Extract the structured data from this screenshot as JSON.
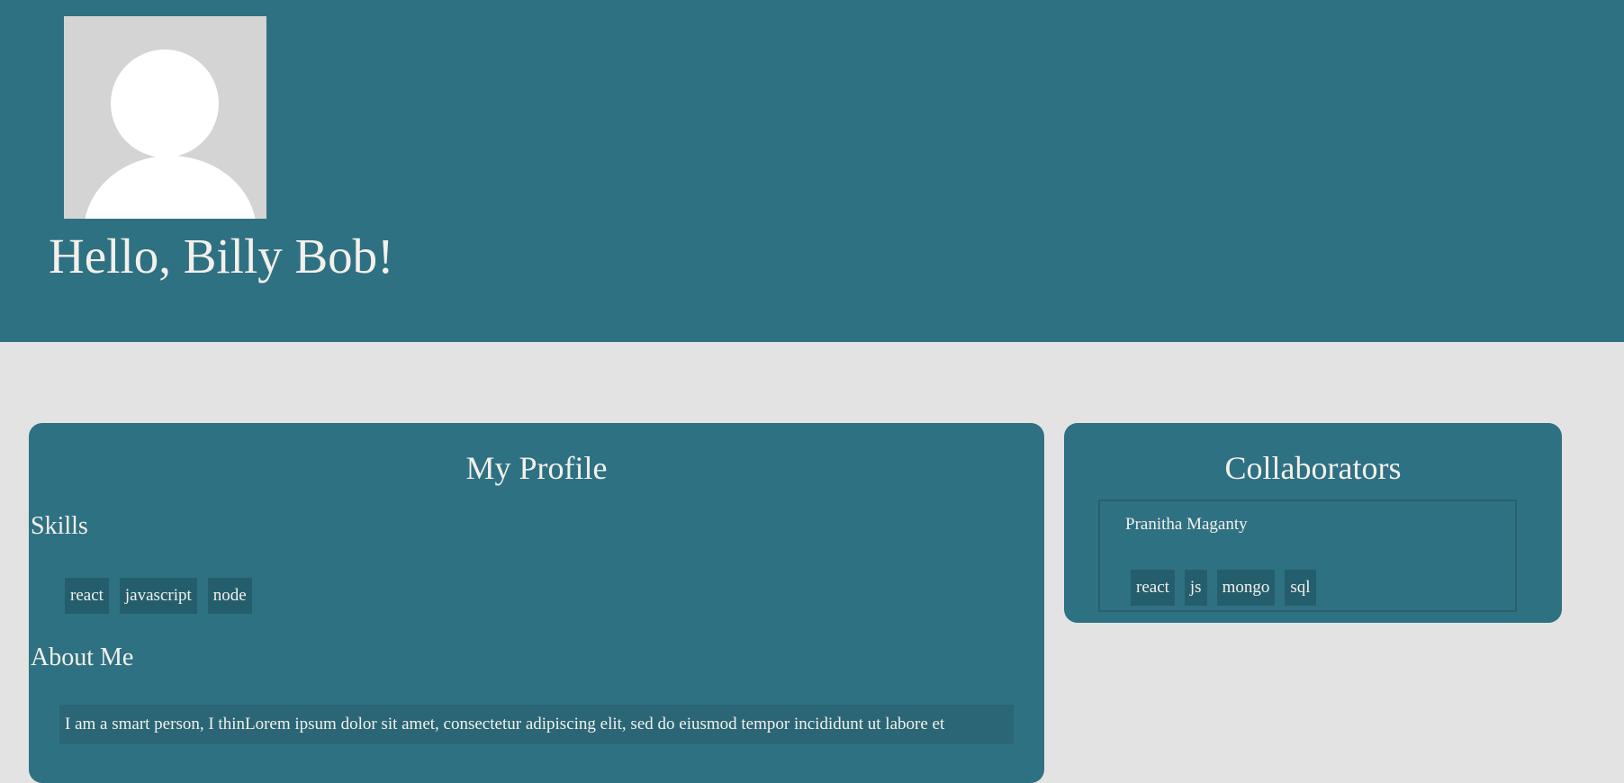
{
  "header": {
    "avatar_icon": "default-user-avatar-icon",
    "greeting": "Hello, Billy Bob!"
  },
  "profile": {
    "title": "My Profile",
    "skills_title": "Skills",
    "skills": [
      "react",
      "javascript",
      "node"
    ],
    "about_title": "About Me",
    "about_text": "I am a smart person, I thinLorem ipsum dolor sit amet, consectetur adipiscing elit, sed do eiusmod tempor incididunt ut labore et"
  },
  "collaborators": {
    "title": "Collaborators",
    "items": [
      {
        "name": "Pranitha Maganty",
        "skills": [
          "react",
          "js",
          "mongo",
          "sql"
        ]
      }
    ]
  },
  "colors": {
    "header_bg": "#2e7182",
    "page_bg": "#e4e3e4",
    "tag_bg": "#245e6c",
    "text": "#f3f0ea"
  }
}
